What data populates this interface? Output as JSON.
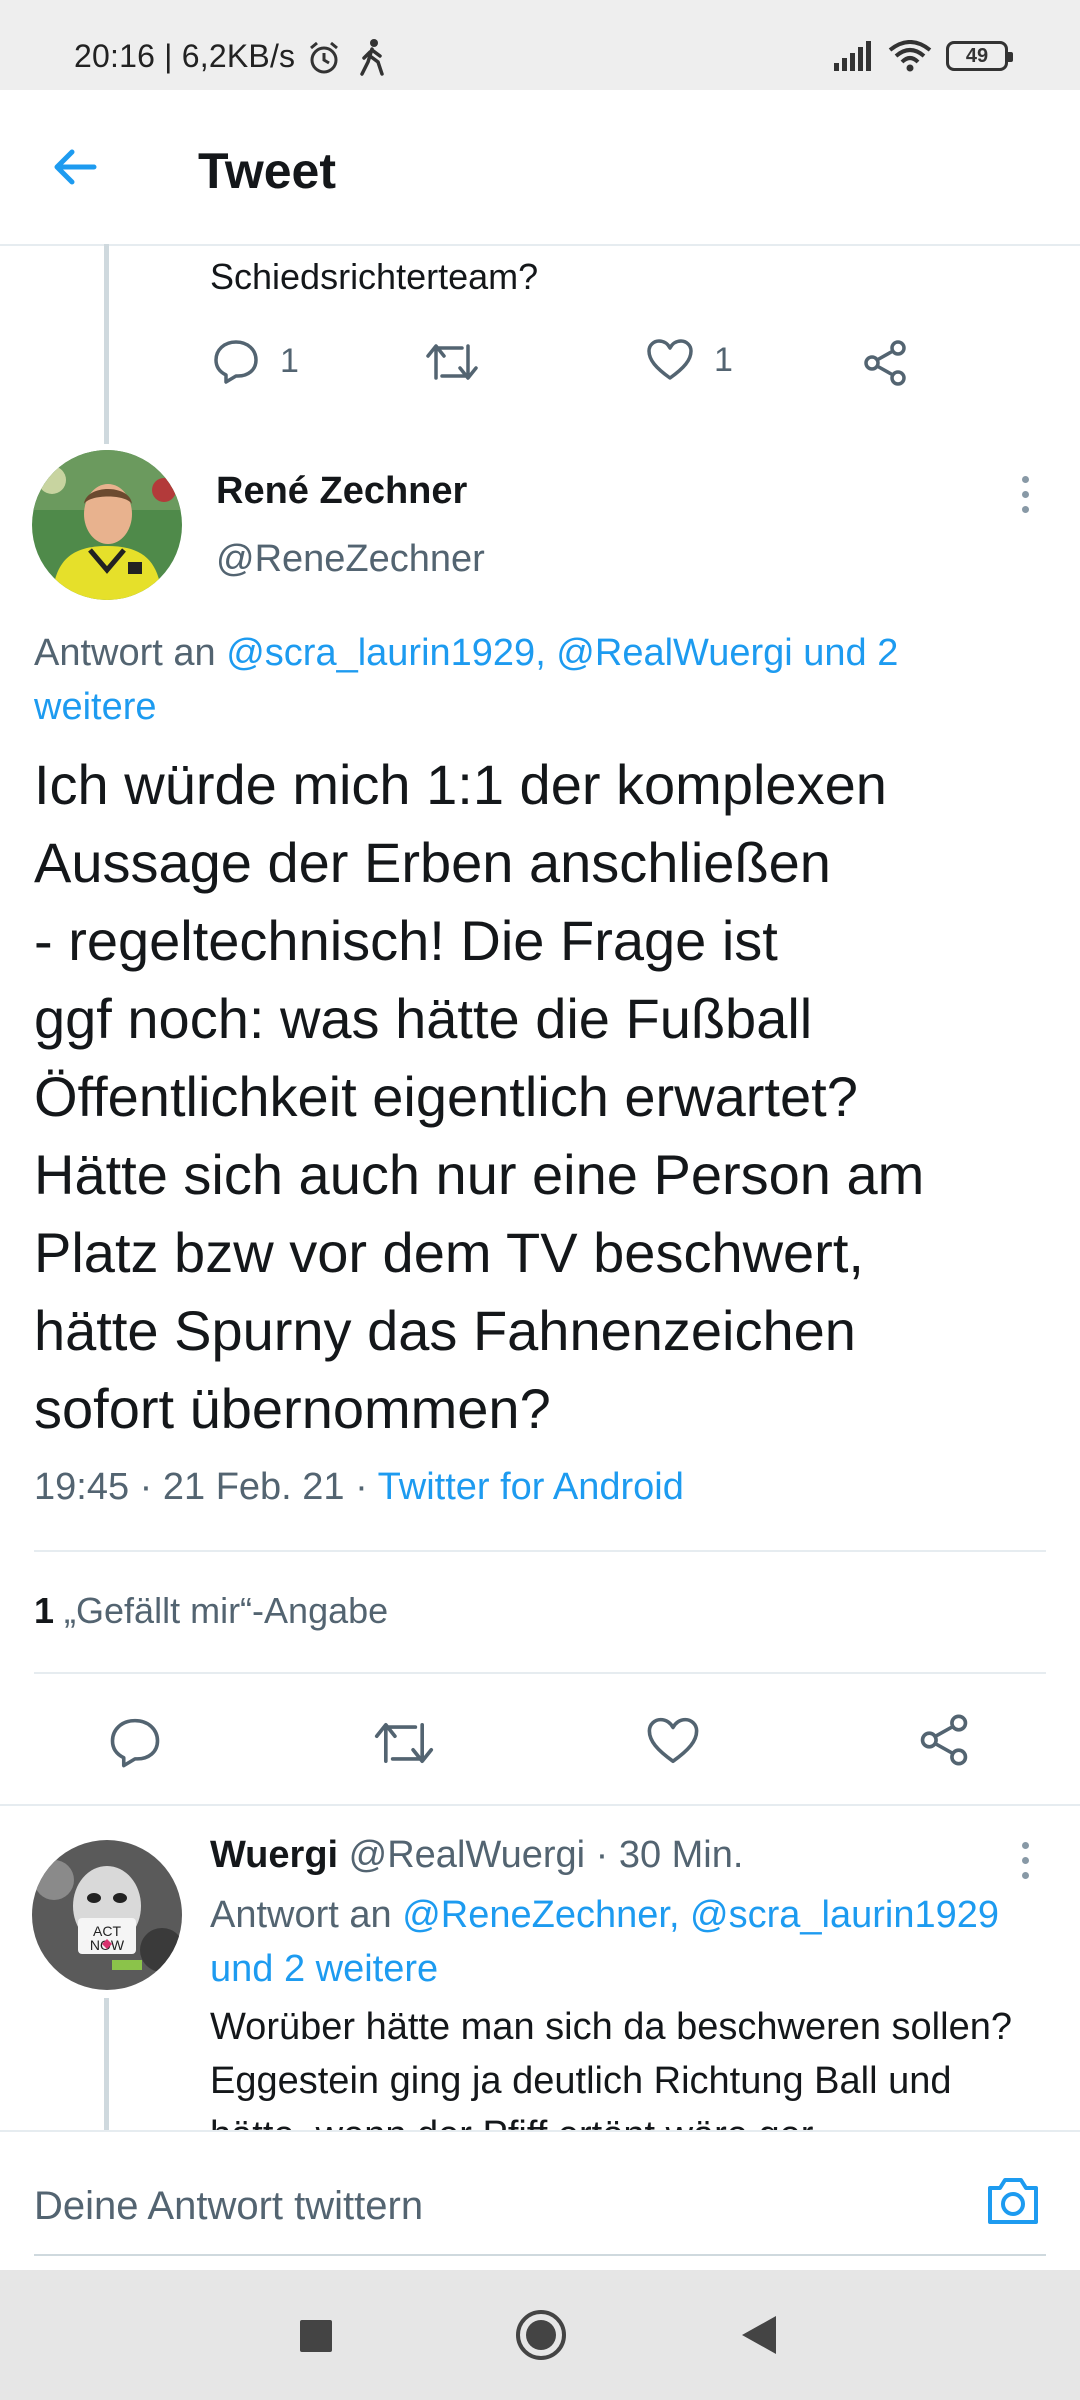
{
  "status_bar": {
    "time": "20:16 | 6,2KB/s",
    "battery": "49",
    "icons": [
      "alarm-icon",
      "walking-icon",
      "signal-icon",
      "wifi-icon",
      "battery-icon"
    ]
  },
  "header": {
    "title": "Tweet",
    "back_icon": "arrow-left-icon"
  },
  "previous_tweet": {
    "text_tail": "Schiedsrichterteam?",
    "reply_count": "1",
    "like_count": "1"
  },
  "main_tweet": {
    "name": "René Zechner",
    "handle": "@ReneZechner",
    "reply_prefix": "Antwort an",
    "reply_targets": "@scra_laurin1929, @RealWuergi und 2 weitere",
    "text": "Ich würde mich 1:1 der komplexen\nAussage der Erben anschließen\n- regeltechnisch! Die Frage ist\nggf noch: was hätte die Fußball\nÖffentlichkeit eigentlich erwartet?\nHätte sich auch nur eine Person am\nPlatz bzw vor dem TV beschwert,\nhätte Spurny das Fahnenzeichen\nsofort übernommen?",
    "time_date": "19:45 · 21 Feb. 21 · ",
    "source": "Twitter for Android",
    "likes_count": "1",
    "likes_label": "„Gefällt mir“-Angabe"
  },
  "reply_tweet": {
    "name": "Wuergi",
    "handle_time": "@RealWuergi · 30 Min.",
    "reply_prefix": "Antwort an",
    "reply_targets": "@ReneZechner, @scra_laurin1929 und 2 weitere",
    "text": "Worüber hätte man sich da beschweren sollen? Eggestein ging ja deutlich Richtung Ball und hätte, wenn der Pfiff ertönt wäre ger"
  },
  "compose": {
    "placeholder": "Deine Antwort twittern",
    "camera_icon": "camera-icon"
  },
  "colors": {
    "accent": "#1d9bf0",
    "secondary_text": "#536471",
    "divider": "#e6ecf0"
  }
}
